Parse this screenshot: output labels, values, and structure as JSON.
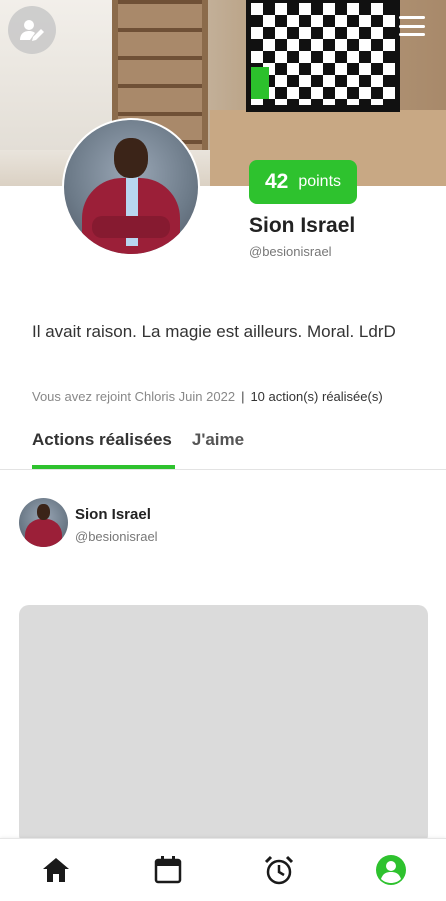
{
  "header": {
    "edit_profile_icon": "user-edit-icon",
    "menu_icon": "hamburger-menu-icon"
  },
  "profile": {
    "points_value": "42",
    "points_label": "points",
    "name": "Sion Israel",
    "handle": "@besionisrael",
    "bio": "Il avait raison. La magie est ailleurs. Moral. LdrD",
    "joined_text": "Vous avez rejoint Chloris Juin 2022",
    "separator": "|",
    "actions_count": "10 action(s) réalisée(s)"
  },
  "tabs": [
    {
      "label": "Actions réalisées",
      "active": true
    },
    {
      "label": "J'aime",
      "active": false
    }
  ],
  "post": {
    "author_name": "Sion Israel",
    "author_handle": "@besionisrael"
  },
  "bottom_nav": [
    {
      "icon": "home-icon",
      "active": false
    },
    {
      "icon": "calendar-icon",
      "active": false
    },
    {
      "icon": "alarm-clock-icon",
      "active": false
    },
    {
      "icon": "profile-icon",
      "active": true
    }
  ],
  "colors": {
    "accent_green": "#2ec22e",
    "placeholder_gray": "#dbdbdb",
    "icon_dark": "#1a1a1a"
  }
}
